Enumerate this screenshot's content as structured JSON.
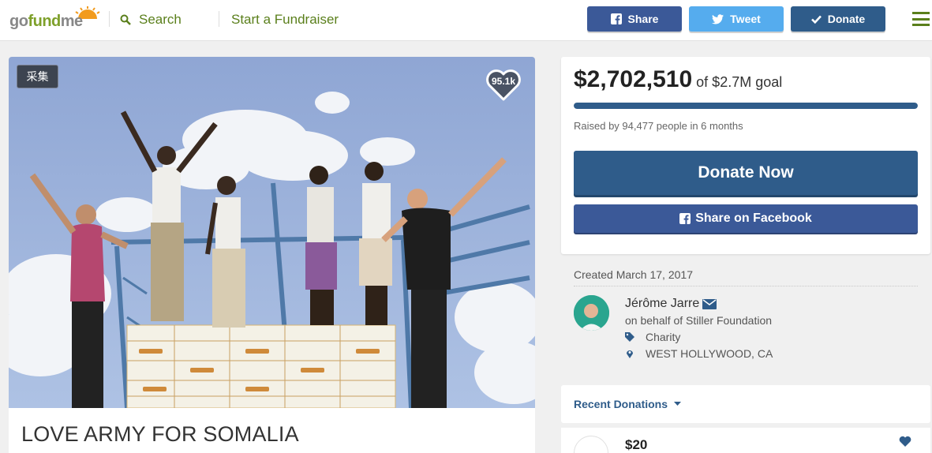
{
  "header": {
    "logo": {
      "part1": "go",
      "part2": "fund",
      "part3": "me"
    },
    "search_label": "Search",
    "start_label": "Start a Fundraiser",
    "share_label": "Share",
    "tweet_label": "Tweet",
    "donate_label": "Donate"
  },
  "hero": {
    "tag": "采集",
    "hearts": "95.1k",
    "title": "LOVE ARMY FOR SOMALIA"
  },
  "campaign": {
    "raised_amount": "$2,702,510",
    "goal_text": "of $2.7M goal",
    "progress_fraction": 1.0,
    "raised_by": "Raised by 94,477 people in 6 months",
    "donate_now": "Donate Now",
    "share_facebook": "Share on Facebook"
  },
  "details": {
    "created": "Created March 17, 2017",
    "organizer": "Jérôme Jarre",
    "behalf": "on behalf of Stiller Foundation",
    "category": "Charity",
    "location": "WEST HOLLYWOOD, CA"
  },
  "donations": {
    "section_label": "Recent Donations",
    "items": [
      {
        "amount": "$20"
      }
    ]
  },
  "colors": {
    "brand_green": "#5a7f1b",
    "primary_blue": "#2f5c8a",
    "facebook_blue": "#3b5998",
    "twitter_blue": "#55acee"
  },
  "icons": [
    "search-icon",
    "facebook-icon",
    "twitter-icon",
    "check-icon",
    "hamburger-icon",
    "heart-icon",
    "envelope-icon",
    "tag-icon",
    "location-pin-icon",
    "chevron-down-icon"
  ]
}
